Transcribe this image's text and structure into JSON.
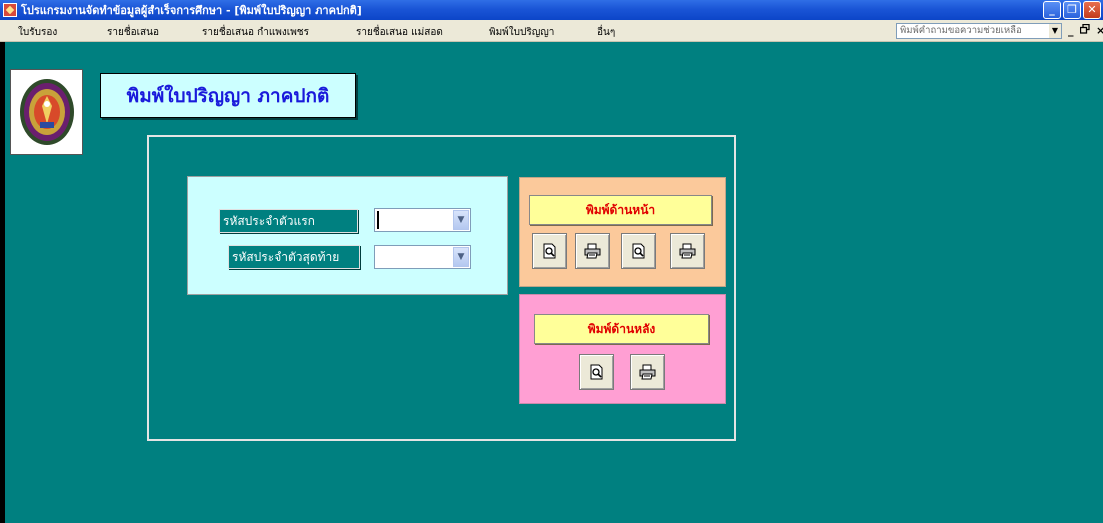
{
  "window": {
    "title": "โปรแกรมงานจัดทำข้อมูลผู้สำเร็จการศึกษา - [พิมพ์ใบปริญญา ภาคปกติ]",
    "buttons": {
      "minimize": "_",
      "restore": "❐",
      "close": "✕"
    }
  },
  "menubar": {
    "items": [
      "ใบรับรอง",
      "รายชื่อเสนอ",
      "รายชื่อเสนอ กำแพงเพชร",
      "รายชื่อเสนอ แม่สอด",
      "พิมพ์ใบปริญญา",
      "อื่นๆ"
    ],
    "help_placeholder": "พิมพ์คำถามขอความช่วยเหลือ",
    "mdi_minimize": "_",
    "mdi_restore": "ᗡ",
    "mdi_close": "×"
  },
  "form": {
    "header": "พิมพ์ใบปริญญา ภาคปกติ",
    "first_id_label": "รหัสประจำตัวแรก",
    "last_id_label": "รหัสประจำตัวสุดท้าย",
    "first_id_value": "",
    "last_id_value": "",
    "front": {
      "title": "พิมพ์ด้านหน้า",
      "icons": [
        "print-preview-icon",
        "printer-icon",
        "print-preview-icon",
        "printer-icon"
      ]
    },
    "back": {
      "title": "พิมพ์ด้านหลัง",
      "icons": [
        "print-preview-icon",
        "printer-icon"
      ]
    }
  },
  "colors": {
    "background": "#008080",
    "cyan_panel": "#ccffff",
    "orange_panel": "#fbc99b",
    "pink_panel": "#ff9fd3",
    "title_fill": "#ffff99",
    "title_text": "#e00000",
    "header_text": "#1a1adb"
  }
}
